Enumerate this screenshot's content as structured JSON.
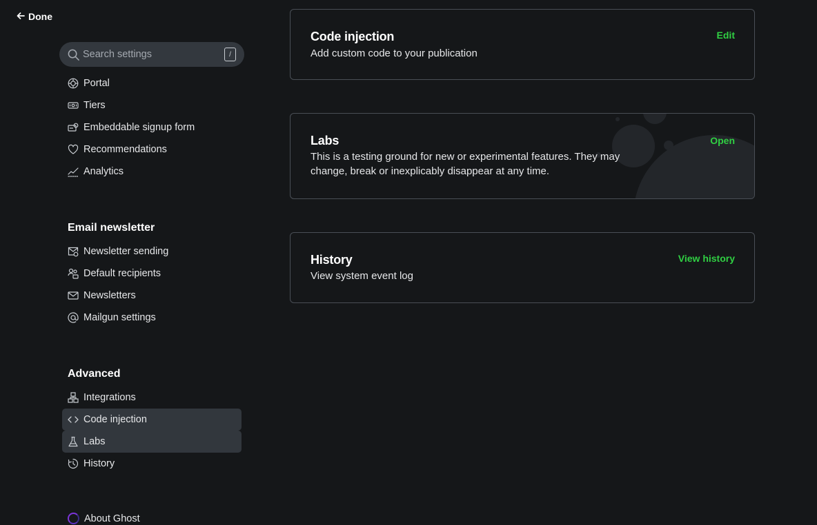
{
  "nav": {
    "done_label": "Done"
  },
  "search": {
    "placeholder": "Search settings",
    "shortcut": "/"
  },
  "sidebar": {
    "membership_items": [
      {
        "label": "Portal",
        "icon": "portal-icon"
      },
      {
        "label": "Tiers",
        "icon": "tiers-icon"
      },
      {
        "label": "Embeddable signup form",
        "icon": "signup-form-icon"
      },
      {
        "label": "Recommendations",
        "icon": "heart-icon"
      },
      {
        "label": "Analytics",
        "icon": "analytics-icon"
      }
    ],
    "email_group": {
      "title": "Email newsletter",
      "items": [
        {
          "label": "Newsletter sending",
          "icon": "newsletter-sending-icon"
        },
        {
          "label": "Default recipients",
          "icon": "recipients-icon"
        },
        {
          "label": "Newsletters",
          "icon": "envelope-icon"
        },
        {
          "label": "Mailgun settings",
          "icon": "at-icon"
        }
      ]
    },
    "advanced_group": {
      "title": "Advanced",
      "items": [
        {
          "label": "Integrations",
          "icon": "integrations-icon"
        },
        {
          "label": "Code injection",
          "icon": "code-icon",
          "active": true
        },
        {
          "label": "Labs",
          "icon": "flask-icon",
          "active": true
        },
        {
          "label": "History",
          "icon": "history-icon"
        }
      ]
    },
    "about_label": "About Ghost"
  },
  "cards": {
    "code_injection": {
      "title": "Code injection",
      "description": "Add custom code to your publication",
      "action": "Edit"
    },
    "labs": {
      "title": "Labs",
      "description": "This is a testing ground for new or experimental features. They may change, break or inexplicably disappear at any time.",
      "action": "Open"
    },
    "history": {
      "title": "History",
      "description": "View system event log",
      "action": "View history"
    }
  },
  "colors": {
    "background": "#151719",
    "accent": "#30cf43",
    "active_item": "#32373d",
    "card_border": "#4a4f56"
  }
}
